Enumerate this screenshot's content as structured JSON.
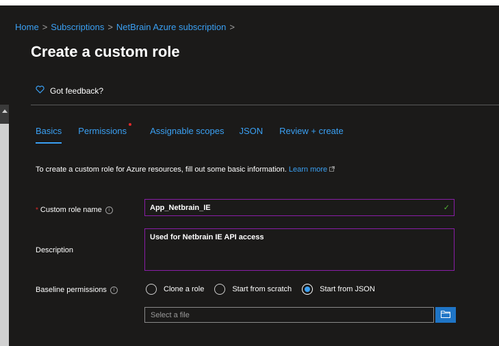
{
  "breadcrumb": {
    "home": "Home",
    "subscriptions": "Subscriptions",
    "subscription": "NetBrain Azure subscription",
    "separator": ">"
  },
  "page_title": "Create a custom role",
  "feedback": {
    "label": "Got feedback?",
    "icon": "heart-icon"
  },
  "tabs": [
    {
      "label": "Basics",
      "active": true
    },
    {
      "label": "Permissions",
      "has_indicator": true
    },
    {
      "label": "Assignable scopes"
    },
    {
      "label": "JSON"
    },
    {
      "label": "Review + create"
    }
  ],
  "intro": {
    "text": "To create a custom role for Azure resources, fill out some basic information.",
    "link": "Learn more"
  },
  "form": {
    "role_name": {
      "label": "Custom role name",
      "value": "App_Netbrain_IE",
      "required": true,
      "valid": true
    },
    "description": {
      "label": "Description",
      "value": "Used for Netbrain IE API access"
    },
    "baseline": {
      "label": "Baseline permissions",
      "options": [
        {
          "label": "Clone a role",
          "checked": false
        },
        {
          "label": "Start from scratch",
          "checked": false
        },
        {
          "label": "Start from JSON",
          "checked": true
        }
      ],
      "file_placeholder": "Select a file"
    }
  },
  "colors": {
    "accent": "#3aa0f3",
    "field_border": "#8a1ea8",
    "required": "#e02a2a",
    "valid": "#54b435",
    "background": "#1b1a19"
  }
}
